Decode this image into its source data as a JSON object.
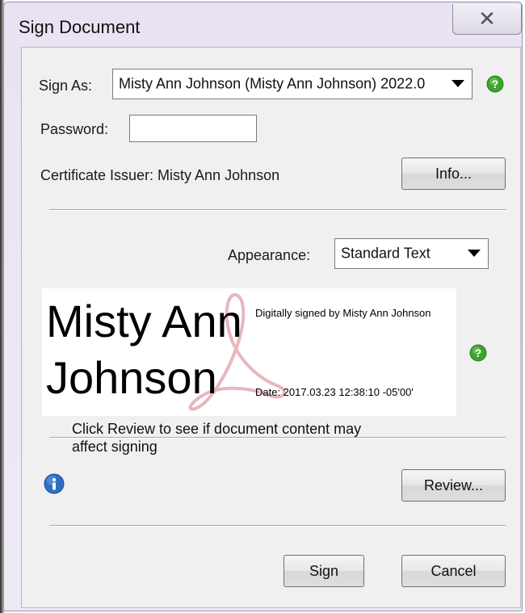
{
  "dialog": {
    "title": "Sign Document",
    "close_glyph": "✕"
  },
  "sign_as": {
    "label": "Sign As:",
    "value": "Misty Ann Johnson (Misty Ann Johnson) 2022.0"
  },
  "password": {
    "label": "Password:",
    "value": ""
  },
  "certificate": {
    "issuer_text": "Certificate Issuer: Misty Ann Johnson",
    "info_button": "Info..."
  },
  "appearance": {
    "label": "Appearance:",
    "value": "Standard Text"
  },
  "signature_preview": {
    "name_line1": "Misty Ann",
    "name_line2": "Johnson",
    "signed_by": "Digitally signed by Misty Ann Johnson",
    "date": "Date: 2017.03.23 12:38:10 -05'00'"
  },
  "review": {
    "note": "Click Review to see if document content may affect signing",
    "button": "Review..."
  },
  "actions": {
    "sign": "Sign",
    "cancel": "Cancel"
  },
  "icons": {
    "help": "help-icon",
    "info": "info-icon",
    "dropdown": "chevron-down-icon",
    "close": "close-icon"
  },
  "colors": {
    "help_green": "#3aa52a",
    "info_blue": "#2e6fc4",
    "title_bar": "#e9e2f2",
    "watermark": "#e7b7bd"
  }
}
